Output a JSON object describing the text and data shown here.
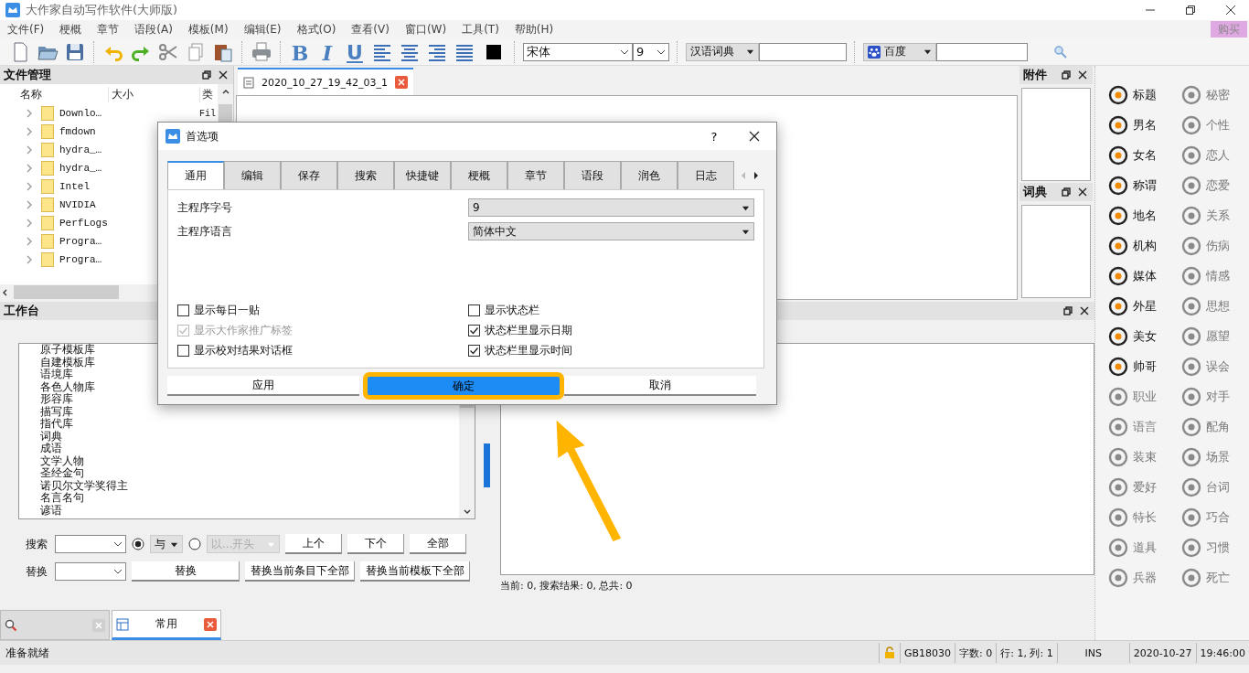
{
  "window": {
    "title": "大作家自动写作软件(大师版)"
  },
  "menu": [
    "文件(F)",
    "梗概",
    "章节",
    "语段(A)",
    "模板(M)",
    "编辑(E)",
    "格式(O)",
    "查看(V)",
    "窗口(W)",
    "工具(T)",
    "帮助(H)"
  ],
  "buy_button": "购买",
  "toolbar": {
    "format_buttons": [
      {
        "label": "B",
        "kind": "bold"
      },
      {
        "label": "I",
        "kind": "italic"
      },
      {
        "label": "U",
        "kind": "underline"
      }
    ],
    "font": "宋体",
    "font_size": "9",
    "dictionary": "汉语词典",
    "search_engine": "百度"
  },
  "file_panel": {
    "title": "文件管理",
    "columns": [
      "名称",
      "大小",
      "类"
    ],
    "rows": [
      {
        "name": "Downlo…",
        "type": "Fil"
      },
      {
        "name": "fmdown"
      },
      {
        "name": "hydra_…"
      },
      {
        "name": "hydra_…"
      },
      {
        "name": "Intel"
      },
      {
        "name": "NVIDIA"
      },
      {
        "name": "PerfLogs"
      },
      {
        "name": "Progra…"
      },
      {
        "name": "Progra…"
      }
    ]
  },
  "document_tab": {
    "title": "2020_10_27_19_42_03_1"
  },
  "attachments_panel": {
    "title": "附件"
  },
  "dictionary_panel": {
    "title": "词典"
  },
  "workbench": {
    "title": "工作台",
    "items": [
      "原子模板库",
      "自建模板库",
      "语境库",
      "各色人物库",
      "形容库",
      "描写库",
      "指代库",
      "词典",
      "成语",
      "文学人物",
      "圣经金句",
      "诺贝尔文学奖得主",
      "名言名句",
      "谚语"
    ],
    "search": {
      "label": "搜索",
      "modes": [
        {
          "label": "与",
          "selected": true,
          "disabled": false
        },
        {
          "label": "以...开头",
          "selected": false,
          "disabled": true
        }
      ],
      "buttons": [
        "上个",
        "下个",
        "全部"
      ]
    },
    "replace": {
      "label": "替换",
      "buttons": [
        "替换",
        "替换当前条目下全部",
        "替换当前模板下全部"
      ]
    },
    "result_status": "当前: 0, 搜索结果: 0, 总共: 0"
  },
  "bottom_tabs": [
    {
      "kind": "search",
      "selected": false
    },
    {
      "kind": "list",
      "label": "常用",
      "selected": true
    }
  ],
  "palette": [
    {
      "label": "标题",
      "disabled": false
    },
    {
      "label": "秘密",
      "disabled": true
    },
    {
      "label": "男名",
      "disabled": false
    },
    {
      "label": "个性",
      "disabled": true
    },
    {
      "label": "女名",
      "disabled": false
    },
    {
      "label": "恋人",
      "disabled": true
    },
    {
      "label": "称谓",
      "disabled": false
    },
    {
      "label": "恋爱",
      "disabled": true
    },
    {
      "label": "地名",
      "disabled": false
    },
    {
      "label": "关系",
      "disabled": true
    },
    {
      "label": "机构",
      "disabled": false
    },
    {
      "label": "伤病",
      "disabled": true
    },
    {
      "label": "媒体",
      "disabled": false
    },
    {
      "label": "情感",
      "disabled": true
    },
    {
      "label": "外星",
      "disabled": false
    },
    {
      "label": "思想",
      "disabled": true
    },
    {
      "label": "美女",
      "disabled": false
    },
    {
      "label": "愿望",
      "disabled": true
    },
    {
      "label": "帅哥",
      "disabled": false
    },
    {
      "label": "误会",
      "disabled": true
    },
    {
      "label": "职业",
      "disabled": true
    },
    {
      "label": "对手",
      "disabled": true
    },
    {
      "label": "语言",
      "disabled": true
    },
    {
      "label": "配角",
      "disabled": true
    },
    {
      "label": "装束",
      "disabled": true
    },
    {
      "label": "场景",
      "disabled": true
    },
    {
      "label": "爱好",
      "disabled": true
    },
    {
      "label": "台词",
      "disabled": true
    },
    {
      "label": "特长",
      "disabled": true
    },
    {
      "label": "巧合",
      "disabled": true
    },
    {
      "label": "道具",
      "disabled": true
    },
    {
      "label": "习惯",
      "disabled": true
    },
    {
      "label": "兵器",
      "disabled": true
    },
    {
      "label": "死亡",
      "disabled": true
    }
  ],
  "status_bar": {
    "message": "准备就绪",
    "encoding": "GB18030",
    "word_count": "字数: 0",
    "position": "行: 1, 列: 1",
    "insert_mode": "INS",
    "date": "2020-10-27",
    "time": "19:46:00"
  },
  "dialog": {
    "title": "首选项",
    "help": "?",
    "tabs": [
      {
        "label": "通用",
        "selected": true
      },
      {
        "label": "编辑",
        "selected": false
      },
      {
        "label": "保存",
        "selected": false
      },
      {
        "label": "搜索",
        "selected": false
      },
      {
        "label": "快捷键",
        "selected": false
      },
      {
        "label": "梗概",
        "selected": false
      },
      {
        "label": "章节",
        "selected": false
      },
      {
        "label": "语段",
        "selected": false
      },
      {
        "label": "润色",
        "selected": false
      },
      {
        "label": "日志",
        "selected": false
      }
    ],
    "fields": [
      {
        "label": "主程序字号",
        "value": "9"
      },
      {
        "label": "主程序语言",
        "value": "简体中文"
      }
    ],
    "options": [
      {
        "label": "显示每日一贴",
        "checked": false,
        "disabled": false
      },
      {
        "label": "显示状态栏",
        "checked": false,
        "disabled": false
      },
      {
        "label": "显示大作家推广标签",
        "checked": true,
        "disabled": true
      },
      {
        "label": "状态栏里显示日期",
        "checked": true,
        "disabled": false
      },
      {
        "label": "显示校对结果对话框",
        "checked": false,
        "disabled": false
      },
      {
        "label": "状态栏里显示时间",
        "checked": true,
        "disabled": false
      }
    ],
    "buttons": [
      {
        "label": "应用",
        "highlighted": false
      },
      {
        "label": "确定",
        "highlighted": true
      },
      {
        "label": "取消",
        "highlighted": false
      }
    ]
  }
}
